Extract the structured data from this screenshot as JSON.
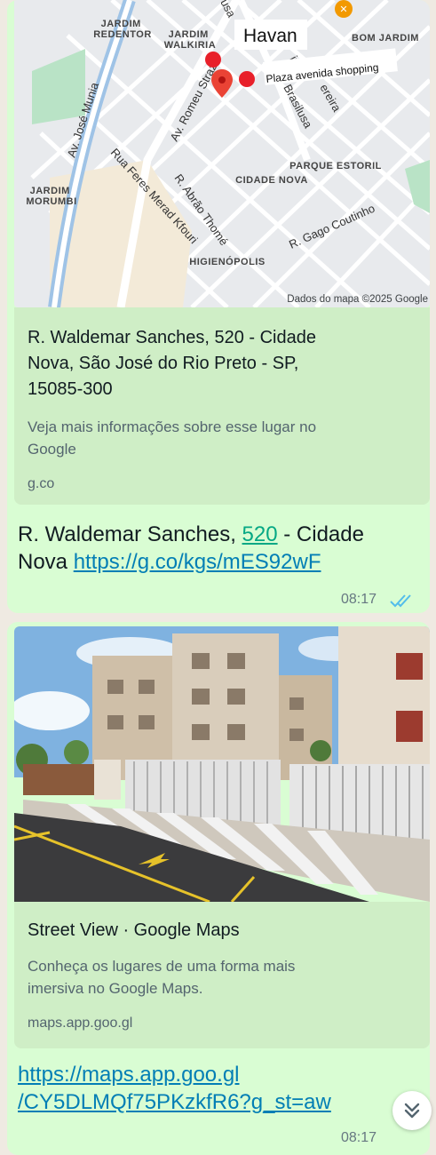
{
  "message1": {
    "map": {
      "labels": {
        "jardim_redentor": [
          "JARDIM",
          "REDENTOR"
        ],
        "jardim_walkiria": [
          "JARDIM",
          "WALKIRIA"
        ],
        "bom_jardim": "BOM JARDIM",
        "jardim_morumbi": [
          "JARDIM",
          "MORUMBI"
        ],
        "parque_estoril": "PARQUE ESTORIL",
        "cidade_nova": "CIDADE NOVA",
        "higienopolis": "HIGIENÓPOLIS"
      },
      "streets": {
        "av_jose_munia": "Av. José Munia",
        "av_romeu_strazzi": "Av. Romeu Strazzi",
        "rua_feres_merad_kfouri": "Rua Feres Merad Kfouri",
        "r_abrao_thome": "R. Abrão Thomé",
        "r_gago_coutinho": "R. Gago Coutinho",
        "brasilusa": "Brasilusa",
        "pereira": "ereira",
        "top_fragment": "usa",
        "iva_fragment": "iva-"
      },
      "annotations": {
        "havan": "Havan",
        "plaza": "Plaza avenida shopping"
      },
      "attribution": "Dados do mapa ©2025 Google"
    },
    "preview": {
      "title_lines": [
        "R. Waldemar Sanches, 520 - Cidade",
        "Nova, São José do Rio Preto - SP,",
        "15085-300"
      ],
      "desc_lines": [
        "Veja mais informações sobre esse lugar no",
        "Google"
      ],
      "domain": "g.co"
    },
    "text": {
      "part1": "R. Waldemar Sanches, ",
      "number": "520",
      "part2": " - Cidade",
      "line2_prefix": "Nova ",
      "link": "https://g.co/kgs/mES92wF"
    },
    "time": "08:17"
  },
  "message2": {
    "preview": {
      "title": "Street View · Google Maps",
      "desc_lines": [
        "Conheça os lugares de uma forma mais",
        "imersiva no Google Maps."
      ],
      "domain": "maps.app.goo.gl"
    },
    "link_lines": [
      "https://maps.app.goo.gl",
      "/CY5DLMQf75PKzkfR6?g_st=aw"
    ],
    "time": "08:17"
  },
  "colors": {
    "bubble": "#d9fdd3",
    "link": "#027eb5",
    "read_ticks": "#53bdeb",
    "marker": "#ea4335"
  }
}
